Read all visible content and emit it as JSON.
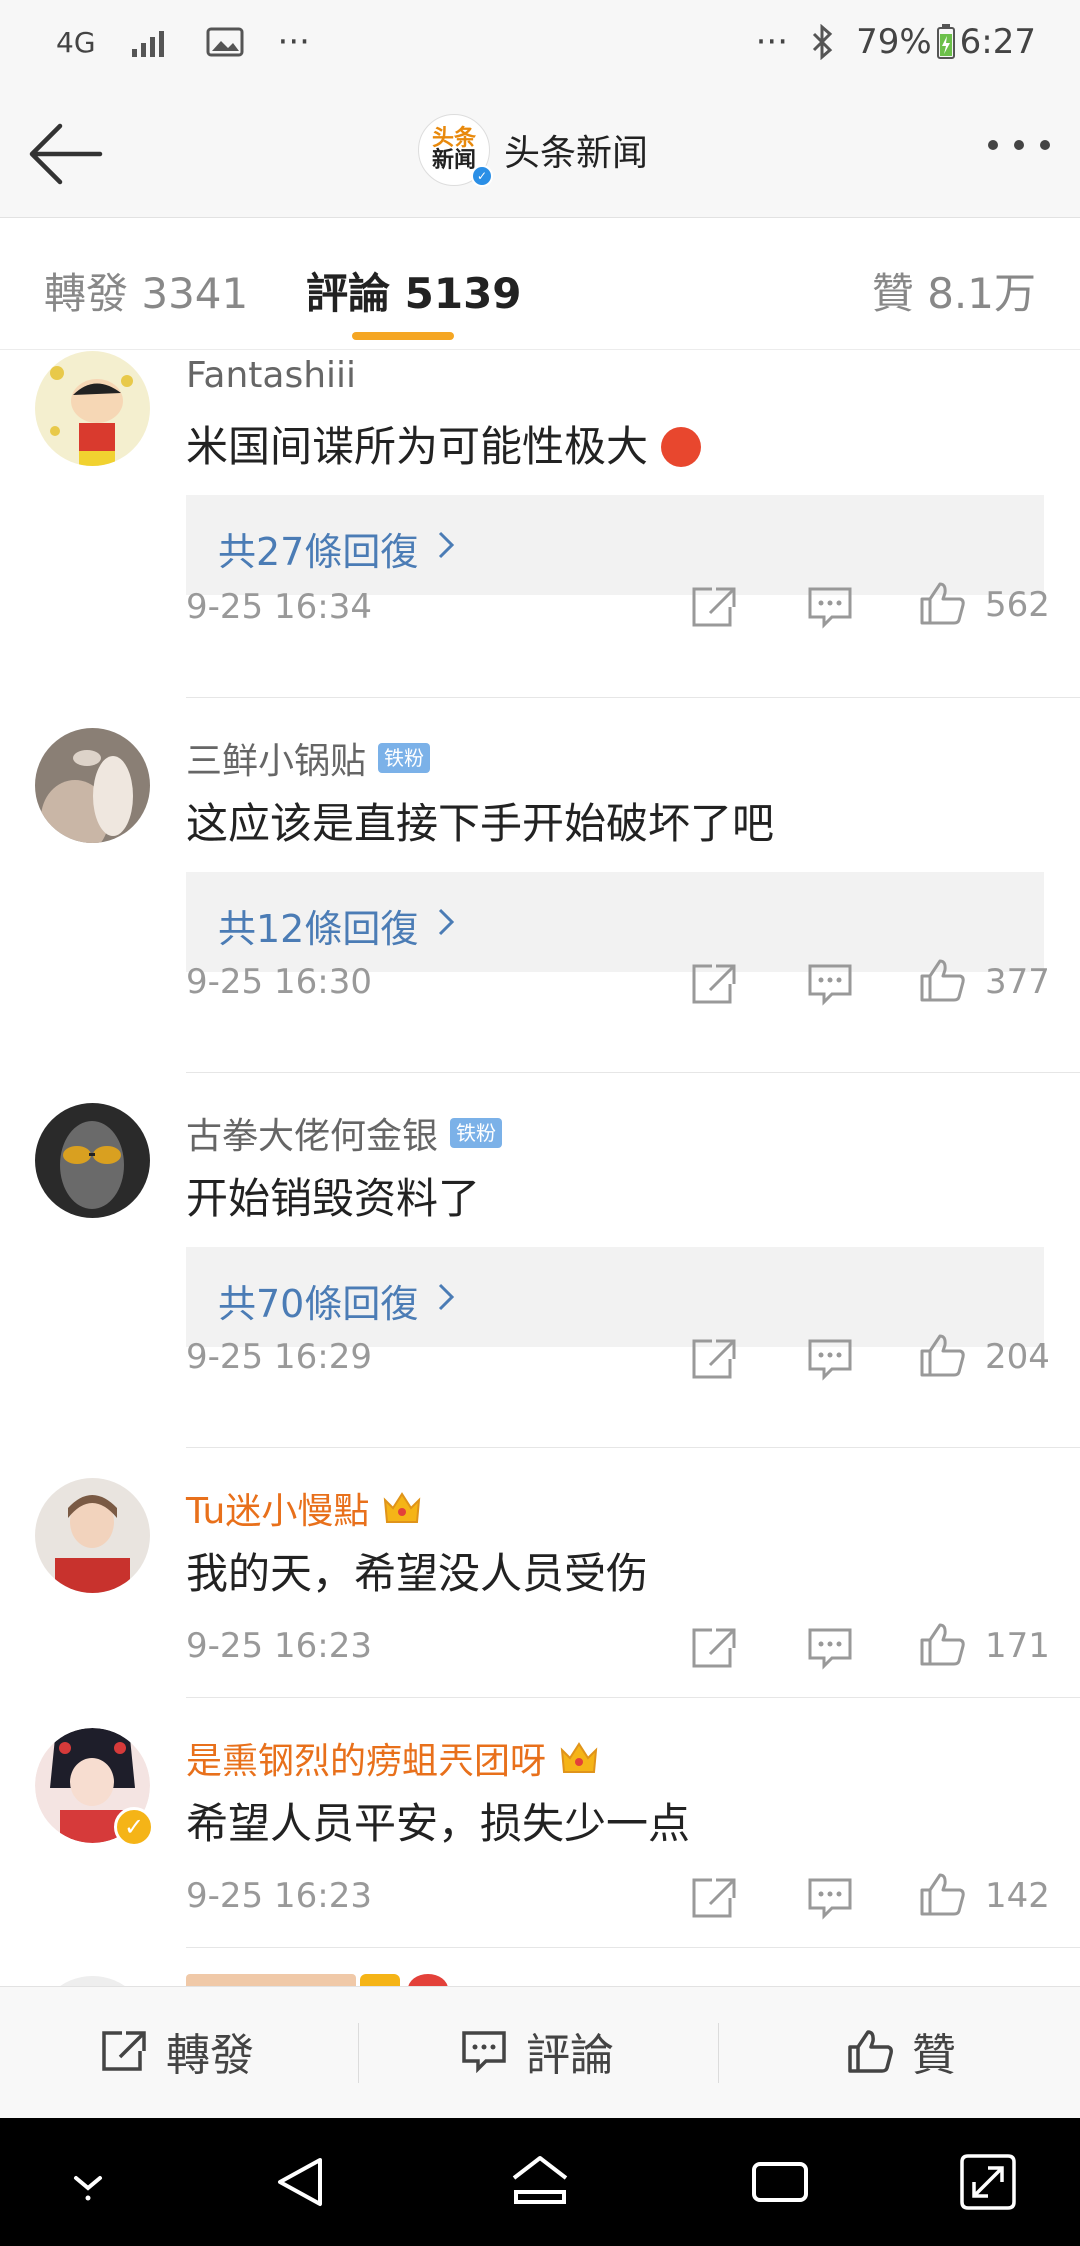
{
  "status_bar": {
    "network": "4G",
    "more_left": "···",
    "more_right": "···",
    "battery": "79%",
    "time": "6:27"
  },
  "header": {
    "logo_line1": "头条",
    "logo_line2": "新闻",
    "title": "头条新闻"
  },
  "tabs": {
    "repost": "轉發 3341",
    "comments": "評論 5139",
    "likes": "贊 8.1万"
  },
  "comments": [
    {
      "username": "Fantashiii",
      "badge": "",
      "text": "米国间谍所为可能性极大",
      "replies": "共27條回復",
      "time": "9-25 16:34",
      "likes": "562"
    },
    {
      "username": "三鲜小锅贴",
      "badge": "铁粉",
      "text": "这应该是直接下手开始破坏了吧",
      "replies": "共12條回復",
      "time": "9-25 16:30",
      "likes": "377"
    },
    {
      "username": "古拳大佬何金银",
      "badge": "铁粉",
      "text": "开始销毁资料了",
      "replies": "共70條回復",
      "time": "9-25 16:29",
      "likes": "204"
    },
    {
      "username": "Tu迷小慢點",
      "badge": "",
      "text": "我的天，希望没人员受伤",
      "replies": "",
      "time": "9-25 16:23",
      "likes": "171"
    },
    {
      "username": "是熏钢烈的痨蛆兲团呀",
      "badge": "",
      "text": "希望人员平安，损失少一点",
      "replies": "",
      "time": "9-25 16:23",
      "likes": "142"
    }
  ],
  "bottom_bar": {
    "repost": "轉發",
    "comment": "評論",
    "like": "贊"
  },
  "colors": {
    "accent": "#f5a623",
    "link": "#4b7cb5",
    "vip_name": "#e8701b",
    "fan_badge": "#7bb1e8"
  },
  "icons": [
    "back-arrow-icon",
    "more-icon",
    "share-icon",
    "comment-icon",
    "like-icon",
    "crown-icon",
    "chevron-right-icon"
  ]
}
